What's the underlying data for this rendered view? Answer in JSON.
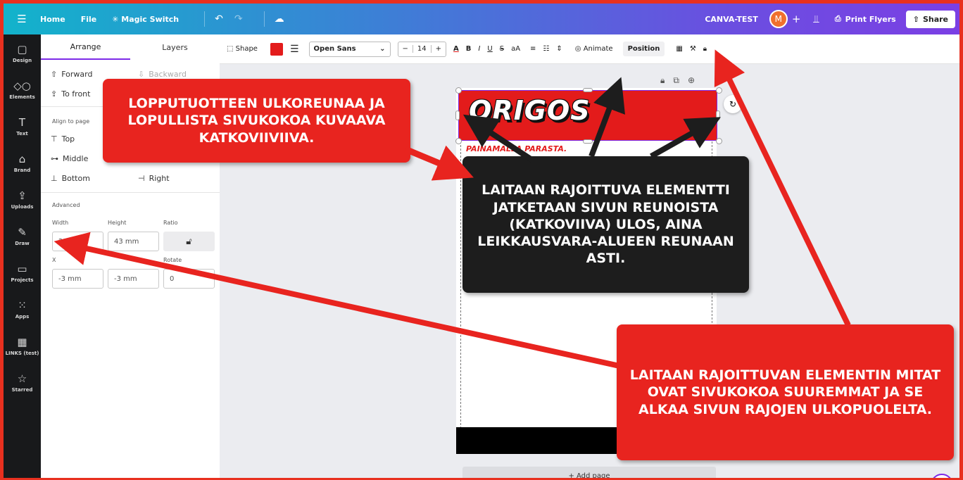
{
  "topbar": {
    "home": "Home",
    "file": "File",
    "magic_switch": "Magic Switch",
    "project_name": "CANVA-TEST",
    "avatar_letter": "M",
    "print_flyers": "Print Flyers",
    "share": "Share"
  },
  "rail": {
    "items": [
      {
        "label": "Design",
        "icon": "layout-icon"
      },
      {
        "label": "Elements",
        "icon": "shapes-icon"
      },
      {
        "label": "Text",
        "icon": "text-icon"
      },
      {
        "label": "Brand",
        "icon": "brand-icon"
      },
      {
        "label": "Uploads",
        "icon": "upload-icon"
      },
      {
        "label": "Draw",
        "icon": "draw-icon"
      },
      {
        "label": "Projects",
        "icon": "folder-icon"
      },
      {
        "label": "Apps",
        "icon": "apps-icon"
      },
      {
        "label": "LINKS (test)",
        "icon": "links-icon"
      },
      {
        "label": "Starred",
        "icon": "star-icon"
      }
    ]
  },
  "panel": {
    "tabs": [
      "Arrange",
      "Layers"
    ],
    "forward": "Forward",
    "backward": "Backward",
    "to_front": "To front",
    "align_heading": "Align to page",
    "top": "Top",
    "middle": "Middle",
    "bottom": "Bottom",
    "right": "Right",
    "advanced": "Advanced",
    "width_label": "Width",
    "height_label": "Height",
    "ratio_label": "Ratio",
    "width_value": "216 mm",
    "height_value": "43 mm",
    "x_label": "X",
    "rotate_label": "Rotate",
    "x_value": "-3 mm",
    "y_value": "-3 mm",
    "rotate_value": "0"
  },
  "toolbar": {
    "shape": "Shape",
    "font": "Open Sans",
    "font_size": "14",
    "animate": "Animate",
    "position": "Position",
    "fill_color": "#e31b1b"
  },
  "canvas": {
    "logo_text": "ORIGOS",
    "tagline": "PAINAMALLA PARASTA.",
    "add_page": "+ Add page"
  },
  "callouts": {
    "bleed_line": "LOPPUTUOTTEEN ULKOREUNAA JA LOPULLISTA SIVUKOKOA KUVAAVA KATKOVIIVIIVA.",
    "extend_element": "LAITAAN RAJOITTUVA ELEMENTTI JATKETAAN SIVUN REUNOISTA (KATKOVIIVA) ULOS, AINA LEIKKAUSVARA-ALUEEN REUNAAN ASTI.",
    "element_size": "LAITAAN RAJOITTUVAN ELEMENTIN MITAT OVAT SIVUKOKOA SUUREMMAT JA SE ALKAA SIVUN RAJOJEN ULKOPUOLELTA."
  }
}
